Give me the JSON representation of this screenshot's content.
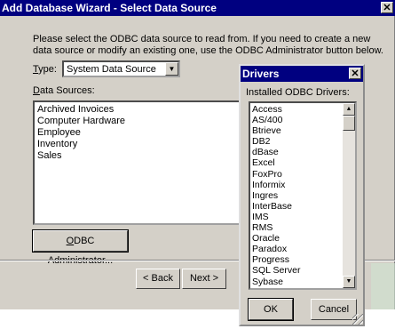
{
  "wizard": {
    "title": "Add Database Wizard - Select Data Source",
    "close_glyph": "✕",
    "instructions": "Please select the ODBC data source to read from. If you need to create a new data source or modify an existing one, use the ODBC Administrator button below.",
    "type_label_prefix": "T",
    "type_label_rest": "ype:",
    "type_value": "System Data Source",
    "data_sources_label_accel": "D",
    "data_sources_label_rest": "ata Sources:",
    "data_sources": [
      "Archived Invoices",
      "Computer Hardware",
      "Employee",
      "Inventory",
      "Sales"
    ],
    "odbc_button_accel": "O",
    "odbc_button_rest": "DBC Administrator...",
    "back_label": "< Back",
    "next_label": "Next >"
  },
  "drivers": {
    "title": "Drivers",
    "close_glyph": "✕",
    "list_label": "Installed ODBC Drivers:",
    "items": [
      "Access",
      "AS/400",
      "Btrieve",
      "DB2",
      "dBase",
      "Excel",
      "FoxPro",
      "Informix",
      "Ingres",
      "InterBase",
      "IMS",
      "RMS",
      "Oracle",
      "Paradox",
      "Progress",
      "SQL Server",
      "Sybase"
    ],
    "ok_label": "OK",
    "cancel_label": "Cancel"
  }
}
